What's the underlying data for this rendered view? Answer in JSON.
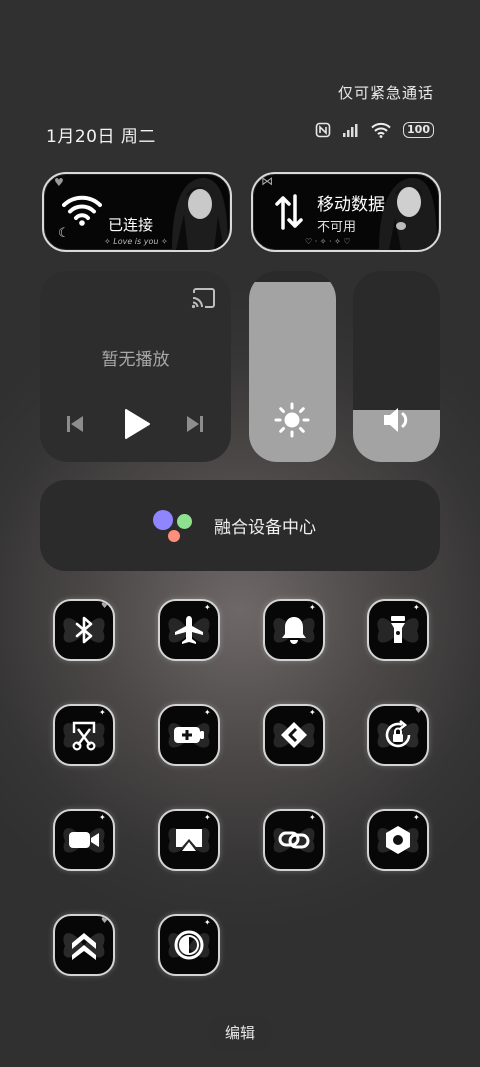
{
  "status": {
    "emergency_text": "仅可紧急通话",
    "date_text": "1月20日 周二",
    "icons": [
      "nfc-icon",
      "signal-icon",
      "wifi-icon",
      "battery-icon"
    ],
    "battery_text": "100"
  },
  "quick_pills": {
    "wifi": {
      "label": "已连接",
      "deco": "✧ Love is you ✧",
      "icon": "wifi-icon"
    },
    "mobile_data": {
      "label": "移动数据",
      "status": "不可用",
      "deco": "♡ · ✧ · ✧ ♡",
      "icon": "data-arrows-icon"
    }
  },
  "media": {
    "title": "暂无播放",
    "controls": [
      "previous-icon",
      "play-icon",
      "next-icon"
    ],
    "cast_icon": "cast-icon"
  },
  "sliders": {
    "brightness_level": 0.94,
    "volume_level": 0.27
  },
  "hub": {
    "label": "融合设备中心",
    "dot_colors": [
      "#8f86ff",
      "#8ee28f",
      "#ff8f7d"
    ]
  },
  "tiles": [
    "bluetooth-icon",
    "airplane-icon",
    "bell-icon",
    "flashlight-icon",
    "screenshot-icon",
    "battery-saver-icon",
    "nearby-share-icon",
    "rotation-lock-icon",
    "screen-record-icon",
    "screen-cast-icon",
    "link-icon",
    "settings-icon",
    "double-chevron-up-icon",
    "dark-mode-icon"
  ],
  "edit_label": "编辑",
  "colors": {
    "panel": "#2b2b2b",
    "slider_fill": "#a3a3a3",
    "tile_bg": "#070707"
  }
}
